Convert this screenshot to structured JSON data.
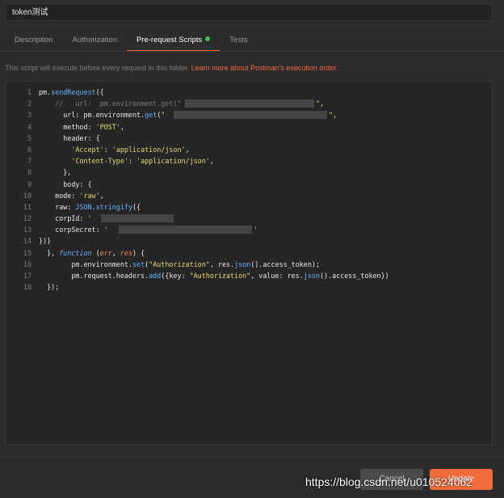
{
  "folder_name": "token测试",
  "tabs": [
    {
      "label": "Description"
    },
    {
      "label": "Authorization"
    },
    {
      "label": "Pre-request Scripts"
    },
    {
      "label": "Tests"
    }
  ],
  "active_tab": "Pre-request Scripts",
  "info": {
    "text": "This script will execute before every request in this folder. ",
    "link": "Learn more about Postman's execution order."
  },
  "code_lines": [
    "pm.sendRequest({",
    "    //   url:  pm.environment.get(\"",
    "      url: pm.environment.get(\"",
    "      method: 'POST',",
    "      header: {",
    "        'Accept': 'application/json',",
    "        'Content-Type': 'application/json',",
    "      },",
    "      body: {",
    "    mode: 'raw',",
    "    raw: JSON.stringify({",
    "    corpId: '",
    "    corpSecret: '",
    "})}",
    "  }, function (err, res) {",
    "        pm.environment.set(\"Authorization\", res.json().access_token);",
    "        pm.request.headers.add({key: \"Authorization\", value: res.json().access_token})",
    "  });"
  ],
  "buttons": {
    "cancel": "Cancel",
    "update": "Update"
  },
  "watermark": "https://blog.csdn.net/u010524062"
}
